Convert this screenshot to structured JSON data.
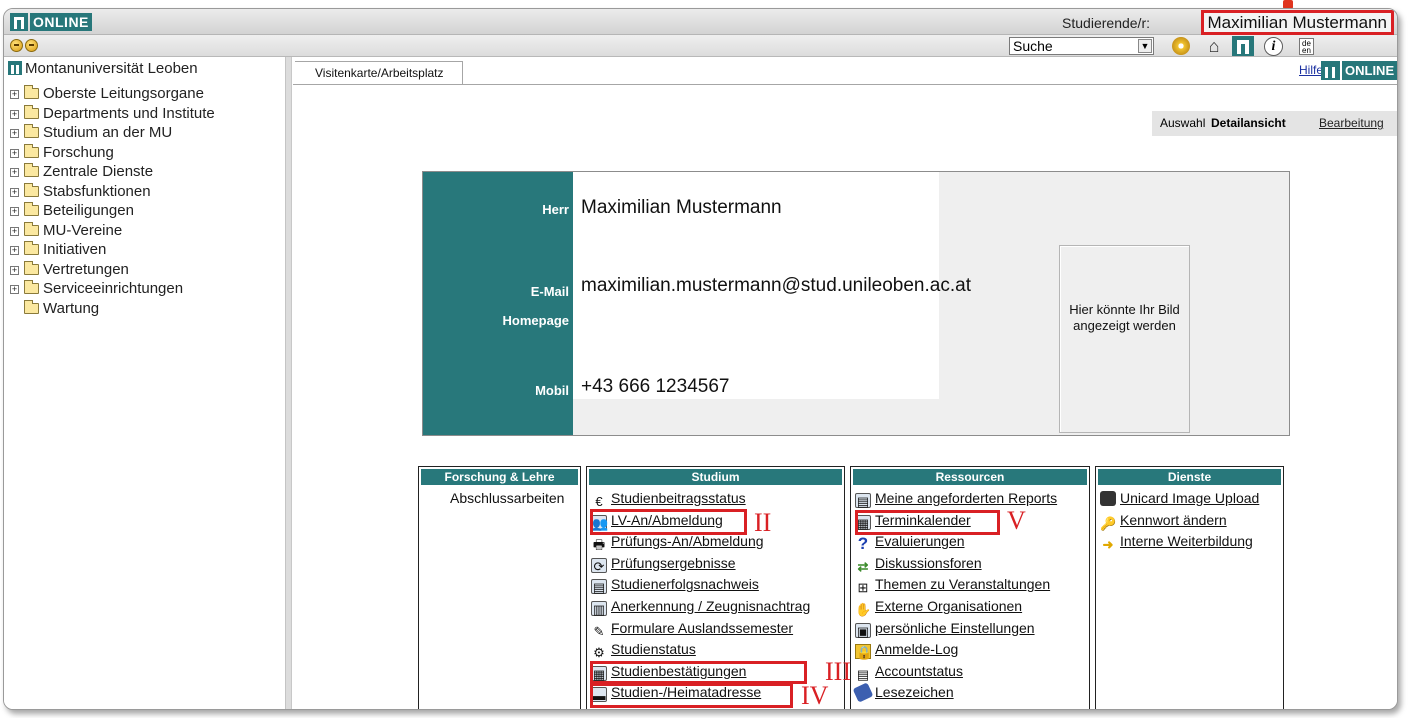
{
  "header": {
    "logo_text": "ONLINE",
    "user_label": "Studierende/r:",
    "user_name": "Maximilian Mustermann"
  },
  "toolbar": {
    "search_value": "Suche",
    "lang_text": "de en"
  },
  "sidebar": {
    "root": "Montanuniversität Leoben",
    "items": [
      {
        "label": "Oberste Leitungsorgane",
        "expandable": true
      },
      {
        "label": "Departments und Institute",
        "expandable": true
      },
      {
        "label": "Studium an der MU",
        "expandable": true
      },
      {
        "label": "Forschung",
        "expandable": true
      },
      {
        "label": "Zentrale Dienste",
        "expandable": true
      },
      {
        "label": "Stabsfunktionen",
        "expandable": true
      },
      {
        "label": "Beteiligungen",
        "expandable": true
      },
      {
        "label": "MU-Vereine",
        "expandable": true
      },
      {
        "label": "Initiativen",
        "expandable": true
      },
      {
        "label": "Vertretungen",
        "expandable": true
      },
      {
        "label": "Serviceeinrichtungen",
        "expandable": true
      },
      {
        "label": "Wartung",
        "expandable": false
      }
    ]
  },
  "content": {
    "tab": "Visitenkarte/Arbeitsplatz",
    "help": "Hilfe",
    "online_logo": "ONLINE",
    "views": {
      "auswahl": "Auswahl",
      "detail": "Detailansicht",
      "bearbeitung": "Bearbeitung"
    }
  },
  "card": {
    "salutation": "Herr",
    "name": "Maximilian Mustermann",
    "email_label": "E-Mail",
    "email": "maximilian.mustermann@stud.unileoben.ac.at",
    "homepage_label": "Homepage",
    "mobile_label": "Mobil",
    "mobile": "+43 666 1234567",
    "photo_text": "Hier könnte Ihr Bild angezeigt werden"
  },
  "sections": {
    "forschung": {
      "title": "Forschung & Lehre",
      "links": [
        "Abschlussarbeiten"
      ]
    },
    "studium": {
      "title": "Studium",
      "links": [
        "Studienbeitragsstatus",
        "LV-An/Abmeldung",
        "Prüfungs-An/Abmeldung",
        "Prüfungsergebnisse",
        "Studienerfolgsnachweis",
        "Anerkennung / Zeugnisnachtrag",
        "Formulare Auslandssemester",
        "Studienstatus",
        "Studienbestätigungen",
        "Studien-/Heimatadresse"
      ]
    },
    "ressourcen": {
      "title": "Ressourcen",
      "links": [
        "Meine angeforderten Reports",
        "Terminkalender",
        "Evaluierungen",
        "Diskussionsforen",
        "Themen zu Veranstaltungen",
        "Externe Organisationen",
        "persönliche Einstellungen",
        "Anmelde-Log",
        "Accountstatus",
        "Lesezeichen"
      ]
    },
    "dienste": {
      "title": "Dienste",
      "links": [
        "Unicard Image Upload",
        "Kennwort ändern",
        "Interne Weiterbildung"
      ]
    }
  },
  "annotations": {
    "ii": "II",
    "iii": "III",
    "iv": "IV",
    "v": "V"
  },
  "colors": {
    "teal": "#28787b",
    "highlight": "#d92024",
    "link": "#1a2fa0"
  }
}
